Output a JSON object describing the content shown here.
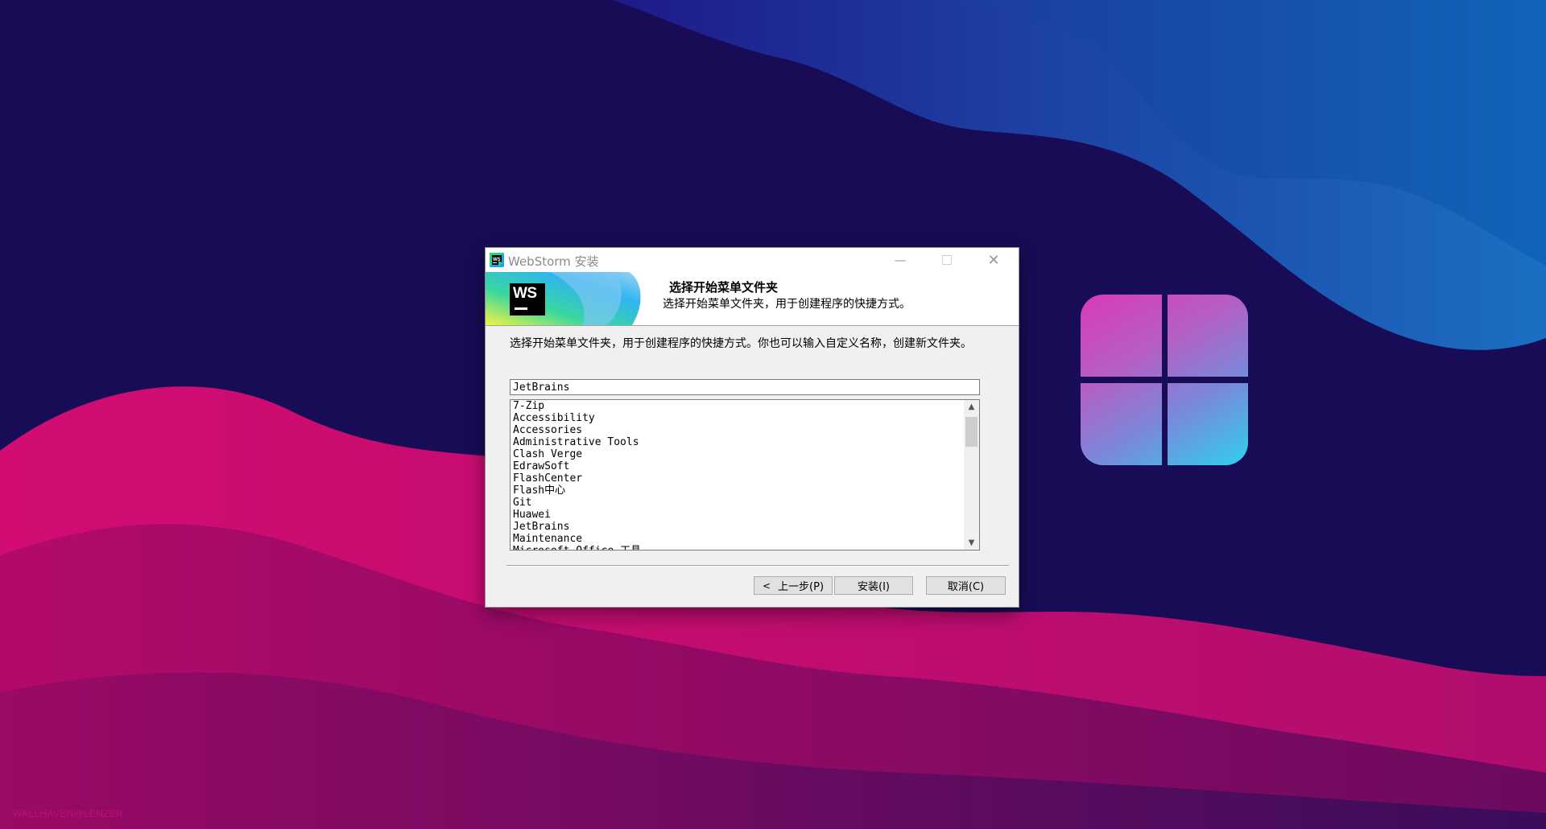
{
  "desktop": {
    "watermark": "WALLHAVEN@LENZER"
  },
  "window": {
    "title": "WebStorm 安装",
    "app_icon": "webstorm-icon",
    "controls": {
      "minimize_icon": "minimize-icon",
      "maximize_icon": "maximize-icon",
      "close_icon": "close-icon"
    }
  },
  "header": {
    "logo_text": "WS",
    "title": "选择开始菜单文件夹",
    "subtitle": "选择开始菜单文件夹，用于创建程序的快捷方式。"
  },
  "content": {
    "description": "选择开始菜单文件夹，用于创建程序的快捷方式。你也可以输入自定义名称，创建新文件夹。",
    "folder_input_value": "JetBrains",
    "folders": [
      "7-Zip",
      "Accessibility",
      "Accessories",
      "Administrative Tools",
      "Clash Verge",
      "EdrawSoft",
      "FlashCenter",
      "Flash中心",
      "Git",
      "Huawei",
      "JetBrains",
      "Maintenance",
      "Microsoft Office 工具"
    ]
  },
  "buttons": {
    "back": "上一步(P)",
    "install": "安装(I)",
    "cancel": "取消(C)"
  },
  "colors": {
    "desktop_bg": "#170c55",
    "window_bg": "#f0f0f0",
    "button_bg": "#e1e1e1"
  }
}
